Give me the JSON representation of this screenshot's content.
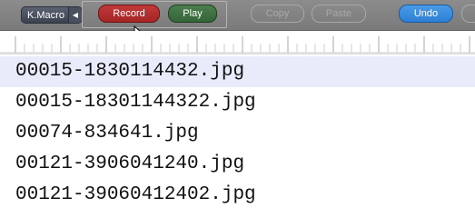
{
  "toolbar": {
    "kmacro_label": "K.Macro",
    "kmacro_arrow": "◀",
    "record_label": "Record",
    "play_label": "Play",
    "copy_label": "Copy",
    "paste_label": "Paste",
    "undo_label": "Undo",
    "copy_enabled": false,
    "paste_enabled": false
  },
  "editor": {
    "lines": [
      "00015-1830114432.jpg",
      "00015-18301144322.jpg",
      "00074-834641.jpg",
      "00121-3906041240.jpg",
      "00121-39060412402.jpg"
    ],
    "current_line_index": 0
  },
  "colors": {
    "record": "#b32e2e",
    "play": "#3f7244",
    "undo": "#3a8ee0",
    "current_line": "#e7ebfa"
  }
}
